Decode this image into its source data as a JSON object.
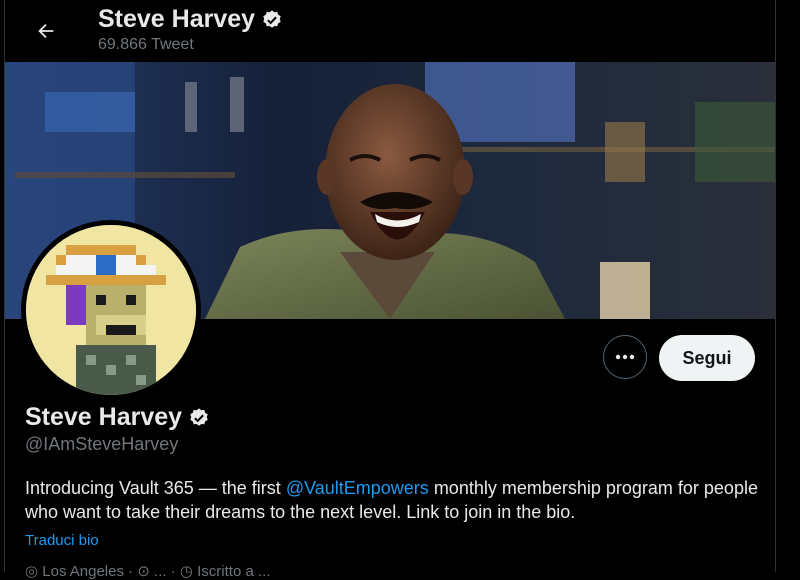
{
  "header": {
    "back_icon": "arrow-left-icon",
    "name": "Steve Harvey",
    "verified_icon": "verified-badge-icon",
    "tweet_count": "69.866 Tweet"
  },
  "profile": {
    "name": "Steve Harvey",
    "handle": "@IAmSteveHarvey",
    "bio_before": "Introducing Vault 365 — the first ",
    "bio_mention": "@VaultEmpowers",
    "bio_after": " monthly membership program for people who want to take their dreams to the next level. Link to join in the bio.",
    "translate_label": "Traduci bio",
    "follow_label": "Segui",
    "more_icon": "more-dots-icon",
    "meta_partial": "◎ Los Angeles · ⊙ ... · ◷ Iscritto a ..."
  },
  "colors": {
    "background": "#000000",
    "text": "#e7e9ea",
    "secondary": "#71767b",
    "link": "#1d9bf0",
    "follow_bg": "#eff3f4"
  }
}
